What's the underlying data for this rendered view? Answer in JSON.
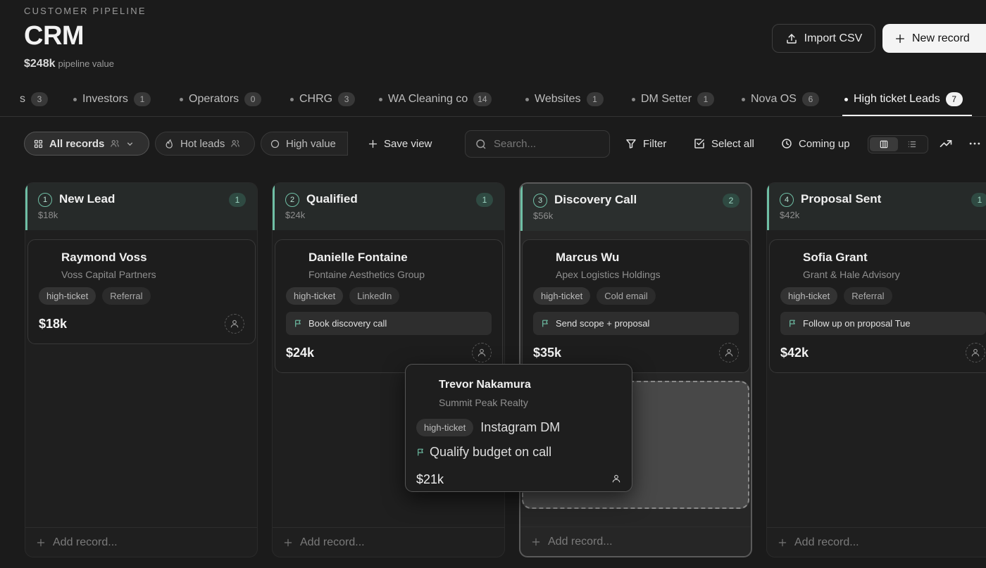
{
  "header": {
    "eyebrow": "CUSTOMER PIPELINE",
    "title": "CRM",
    "pipeline_value": "$248k",
    "pipeline_label": "pipeline value",
    "import_label": "Import CSV",
    "new_record_label": "New record"
  },
  "tabs": [
    {
      "label": "s",
      "count": "3"
    },
    {
      "label": "Investors",
      "count": "1"
    },
    {
      "label": "Operators",
      "count": "0"
    },
    {
      "label": "CHRG",
      "count": "3"
    },
    {
      "label": "WA Cleaning co",
      "count": "14"
    },
    {
      "label": "Websites",
      "count": "1"
    },
    {
      "label": "DM Setter",
      "count": "1"
    },
    {
      "label": "Nova OS",
      "count": "6"
    },
    {
      "label": "High ticket Leads",
      "count": "7",
      "active": true
    }
  ],
  "toolbar": {
    "all_records": "All records",
    "hot_leads": "Hot leads",
    "high_value": "High value",
    "save_view": "Save view",
    "search_placeholder": "Search...",
    "filter": "Filter",
    "select_all": "Select all",
    "coming_up": "Coming up"
  },
  "columns": [
    {
      "num": "1",
      "title": "New Lead",
      "value": "$18k",
      "count": "1",
      "add_label": "Add record...",
      "cards": [
        {
          "name": "Raymond Voss",
          "company": "Voss Capital Partners",
          "tag": "high-ticket",
          "source": "Referral",
          "task": "",
          "amount": "$18k"
        }
      ]
    },
    {
      "num": "2",
      "title": "Qualified",
      "value": "$24k",
      "count": "1",
      "add_label": "Add record...",
      "cards": [
        {
          "name": "Danielle Fontaine",
          "company": "Fontaine Aesthetics Group",
          "tag": "high-ticket",
          "source": "LinkedIn",
          "task": "Book discovery call",
          "amount": "$24k"
        }
      ]
    },
    {
      "num": "3",
      "title": "Discovery Call",
      "value": "$56k",
      "count": "2",
      "add_label": "Add record...",
      "cards": [
        {
          "name": "Marcus Wu",
          "company": "Apex Logistics Holdings",
          "tag": "high-ticket",
          "source": "Cold email",
          "task": "Send scope + proposal",
          "amount": "$35k"
        }
      ]
    },
    {
      "num": "4",
      "title": "Proposal Sent",
      "value": "$42k",
      "count": "1",
      "add_label": "Add record...",
      "cards": [
        {
          "name": "Sofia Grant",
          "company": "Grant & Hale Advisory",
          "tag": "high-ticket",
          "source": "Referral",
          "task": "Follow up on proposal Tue",
          "amount": "$42k"
        }
      ]
    }
  ],
  "dragging_card": {
    "name": "Trevor Nakamura",
    "company": "Summit Peak Realty",
    "tag": "high-ticket",
    "source": "Instagram DM",
    "task": "Qualify budget on call",
    "amount": "$21k"
  },
  "colors": {
    "accent": "#6fbfa5",
    "background": "#1b1b1b"
  },
  "icons": [
    "upload-icon",
    "plus-icon",
    "grid-icon",
    "users-icon",
    "chevron-down-icon",
    "flame-icon",
    "circle-icon",
    "search-icon",
    "filter-icon",
    "check-square-icon",
    "clock-icon",
    "board-icon",
    "list-icon",
    "trend-icon",
    "more-icon",
    "flag-icon",
    "user-icon"
  ]
}
